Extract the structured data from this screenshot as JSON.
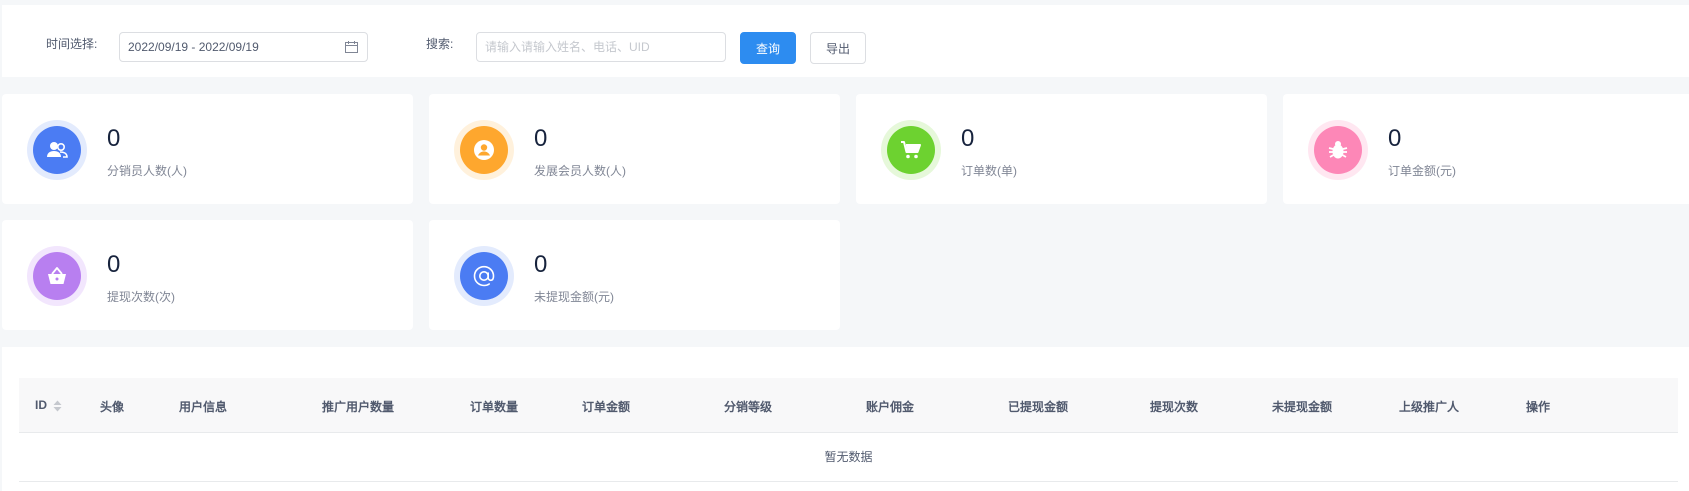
{
  "filter": {
    "time_label": "时间选择:",
    "date_range": "2022/09/19 - 2022/09/19",
    "search_label": "搜索:",
    "search_placeholder": "请输入请输入姓名、电话、UID",
    "search_value": "",
    "query_button": "查询",
    "export_button": "导出"
  },
  "stats": [
    {
      "value": "0",
      "label": "分销员人数(人)",
      "icon": "users-icon",
      "color": "#4b7cf3",
      "ring": "#e3ebfd"
    },
    {
      "value": "0",
      "label": "发展会员人数(人)",
      "icon": "user-circle-icon",
      "color": "#fea72e",
      "ring": "#fff1dc"
    },
    {
      "value": "0",
      "label": "订单数(单)",
      "icon": "cart-icon",
      "color": "#6dd230",
      "ring": "#e6f8da"
    },
    {
      "value": "0",
      "label": "订单金额(元)",
      "icon": "bug-icon",
      "color": "#fd87b7",
      "ring": "#ffe7f1"
    },
    {
      "value": "0",
      "label": "提现次数(次)",
      "icon": "basket-icon",
      "color": "#b87ff0",
      "ring": "#f2e6fd"
    },
    {
      "value": "0",
      "label": "未提现金额(元)",
      "icon": "at-icon",
      "color": "#4b7cf3",
      "ring": "#e3ebfd"
    }
  ],
  "table": {
    "columns": [
      "ID",
      "头像",
      "用户信息",
      "推广用户数量",
      "订单数量",
      "订单金额",
      "分销等级",
      "账户佣金",
      "已提现金额",
      "提现次数",
      "未提现金额",
      "上级推广人",
      "操作"
    ],
    "empty_text": "暂无数据"
  }
}
